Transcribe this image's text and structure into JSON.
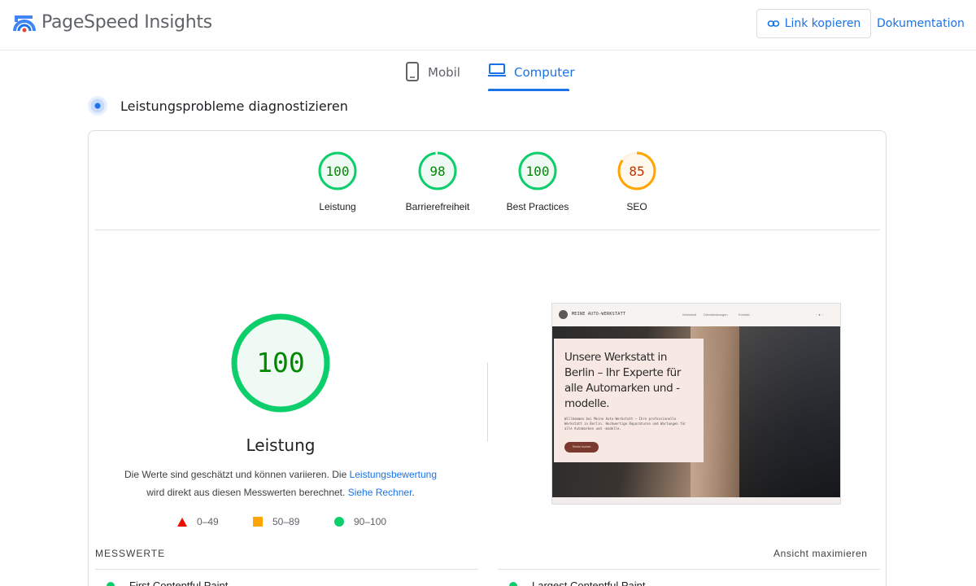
{
  "header": {
    "app_title": "PageSpeed Insights",
    "copy_link": "Link kopieren",
    "documentation": "Dokumentation"
  },
  "tabs": {
    "mobile": "Mobil",
    "desktop": "Computer",
    "active": "desktop"
  },
  "section": {
    "title": "Leistungsprobleme diagnostizieren"
  },
  "scores": [
    {
      "label": "Leistung",
      "value": "100",
      "score": 100,
      "color": "#0cce6b"
    },
    {
      "label": "Barrierefreiheit",
      "value": "98",
      "score": 98,
      "color": "#0cce6b"
    },
    {
      "label": "Best Practices",
      "value": "100",
      "score": 100,
      "color": "#0cce6b"
    },
    {
      "label": "SEO",
      "value": "85",
      "score": 85,
      "color": "#ffa400"
    }
  ],
  "performance": {
    "value": "100",
    "score": 100,
    "label": "Leistung",
    "desc_part1": "Die Werte sind geschätzt und können variieren. Die ",
    "desc_link1": "Leistungsbewertung",
    "desc_part2": "wird direkt aus diesen Messwerten berechnet. ",
    "desc_link2": "Siehe Rechner",
    "desc_part3": "."
  },
  "legend": {
    "poor": "0–49",
    "average": "50–89",
    "good": "90–100"
  },
  "screenshot": {
    "brand": "MEINE AUTO-WERKSTATT",
    "nav": [
      "Werkstatt",
      "Dienstleistungen",
      "Kontakt"
    ],
    "headline": "Unsere Werkstatt in Berlin – Ihr Experte für alle Automarken und -modelle.",
    "body": "Willkommen bei Meine Auto-Werkstatt – Ihre professionelle Werkstatt in Berlin. Hochwertige Reparaturen und Wartungen für alle Automarken und -modelle.",
    "button": "Termin buchen"
  },
  "metrics": {
    "title": "MESSWERTE",
    "maximize": "Ansicht maximieren",
    "items": [
      "First Contentful Paint",
      "Largest Contentful Paint"
    ]
  },
  "colors": {
    "accent": "#1a73e8",
    "good": "#0cce6b",
    "average": "#ffa400",
    "poor": "#eb0f00"
  }
}
